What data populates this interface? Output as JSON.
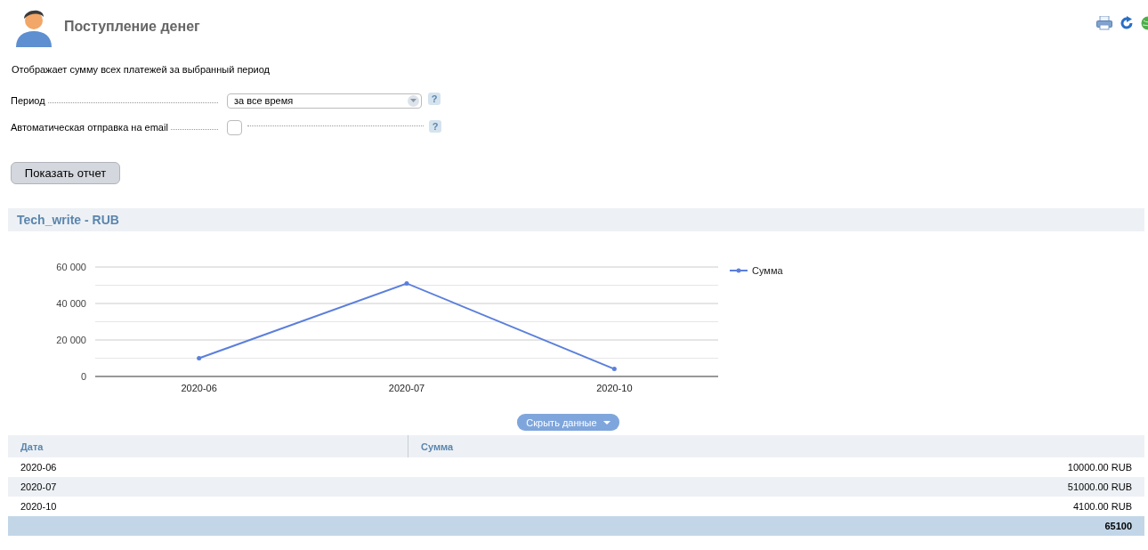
{
  "header": {
    "title": "Поступление денег"
  },
  "description": "Отображает сумму всех платежей за выбранный период",
  "form": {
    "fields": [
      {
        "kind": "select",
        "label": "Период",
        "value": "за все время",
        "help": "?"
      },
      {
        "kind": "checkbox",
        "label": "Автоматическая отправка на email",
        "checked": false,
        "help": "?"
      }
    ],
    "submit": "Показать отчет"
  },
  "report": {
    "title": "Tech_write - RUB",
    "chart_data": {
      "type": "line",
      "categories": [
        "2020-06",
        "2020-07",
        "2020-10"
      ],
      "series": [
        {
          "name": "Сумма",
          "color": "#5b7fdb",
          "values": [
            10000,
            51000,
            4100
          ]
        }
      ],
      "ylim": [
        0,
        60000
      ],
      "yticks": [
        {
          "value": 0,
          "label": "0"
        },
        {
          "value": 20000,
          "label": "20 000"
        },
        {
          "value": 40000,
          "label": "40 000"
        },
        {
          "value": 60000,
          "label": "60 000"
        }
      ]
    },
    "toggle": "Скрыть данные",
    "table": {
      "columns": [
        "Дата",
        "Сумма"
      ],
      "rows": [
        [
          "2020-06",
          "10000.00 RUB"
        ],
        [
          "2020-07",
          "51000.00 RUB"
        ],
        [
          "2020-10",
          "4100.00 RUB"
        ]
      ],
      "total": "65100"
    }
  }
}
